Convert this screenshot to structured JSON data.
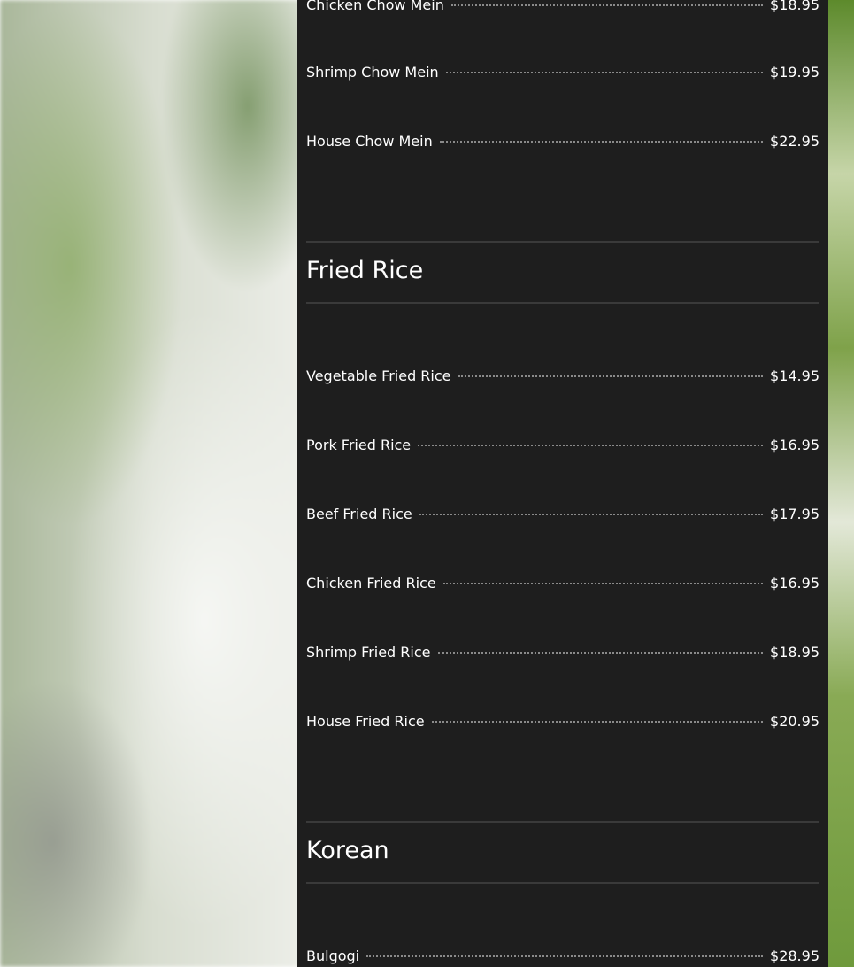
{
  "sections": [
    {
      "title": "",
      "items": [
        {
          "name": "Chicken Chow Mein",
          "price": "$18.95"
        },
        {
          "name": "Shrimp Chow Mein",
          "price": "$19.95"
        },
        {
          "name": "House Chow Mein",
          "price": "$22.95"
        }
      ]
    },
    {
      "title": "Fried Rice",
      "items": [
        {
          "name": "Vegetable Fried Rice",
          "price": "$14.95"
        },
        {
          "name": "Pork Fried Rice",
          "price": "$16.95"
        },
        {
          "name": "Beef Fried Rice",
          "price": "$17.95"
        },
        {
          "name": "Chicken Fried Rice",
          "price": "$16.95"
        },
        {
          "name": "Shrimp Fried Rice",
          "price": "$18.95"
        },
        {
          "name": "House Fried Rice",
          "price": "$20.95"
        }
      ]
    },
    {
      "title": "Korean",
      "items": [
        {
          "name": "Bulgogi",
          "price": "$28.95"
        }
      ]
    }
  ]
}
